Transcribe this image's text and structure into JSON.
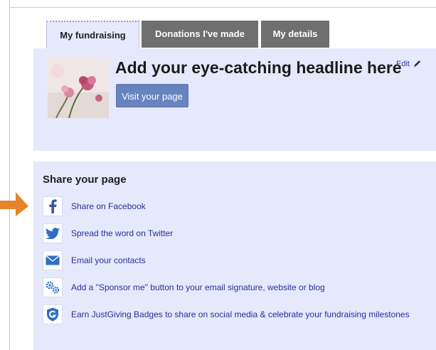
{
  "tabs": [
    {
      "label": "My fundraising",
      "active": true
    },
    {
      "label": "Donations I've made",
      "active": false
    },
    {
      "label": "My details",
      "active": false
    }
  ],
  "header": {
    "headline": "Add your eye-catching headline here",
    "edit_label": "Edit",
    "visit_button": "Visit your page"
  },
  "share": {
    "title": "Share your page",
    "items": [
      {
        "label": "Share on Facebook",
        "icon": "facebook-icon"
      },
      {
        "label": "Spread the word on Twitter",
        "icon": "twitter-icon"
      },
      {
        "label": "Email your contacts",
        "icon": "email-icon"
      },
      {
        "label": "Add a \"Sponsor me\" button to your email signature, website or blog",
        "icon": "gears-icon"
      },
      {
        "label": "Earn JustGiving Badges to share on social media & celebrate your fundraising milestones",
        "icon": "badge-icon"
      }
    ]
  },
  "colors": {
    "panel_bg": "#e6e9fb",
    "tab_inactive": "#6f6f6f",
    "link": "#23319a",
    "button": "#6884bf",
    "arrow": "#e8832a"
  }
}
